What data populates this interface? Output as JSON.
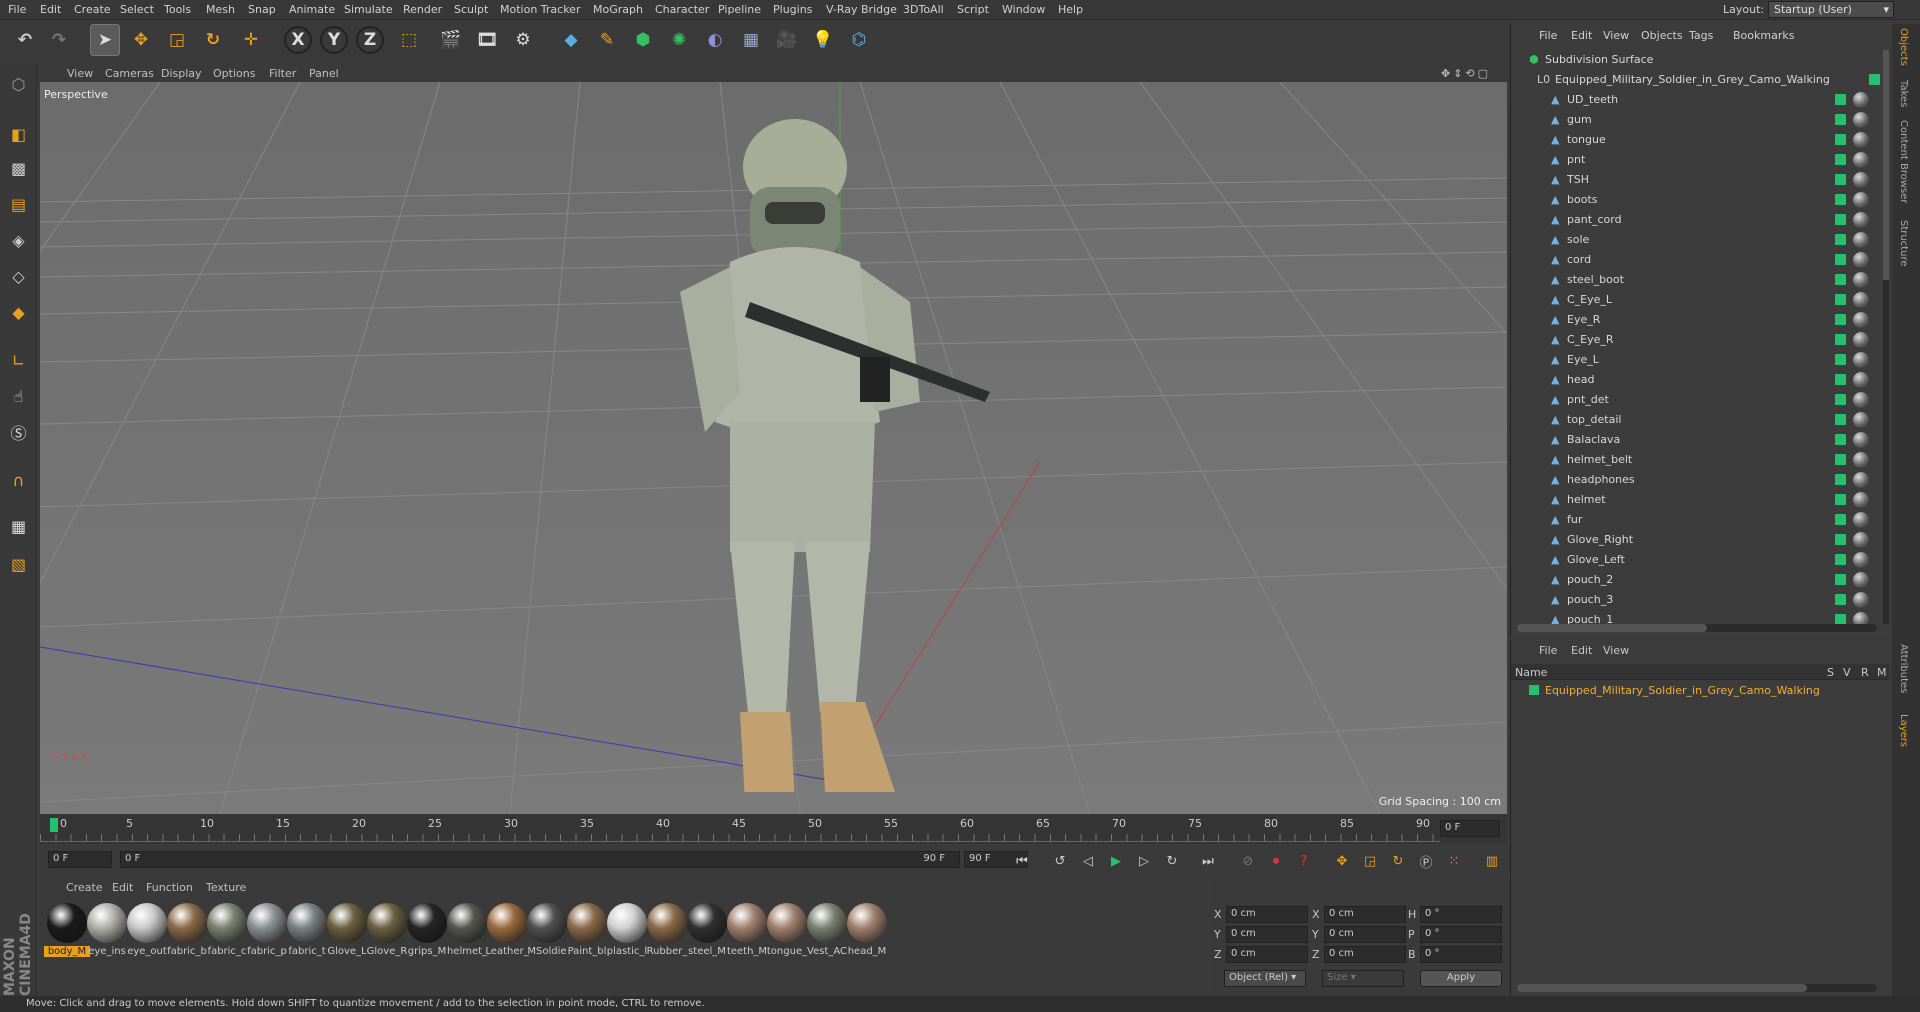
{
  "menubar": {
    "items": [
      "File",
      "Edit",
      "Create",
      "Select",
      "Tools",
      "Mesh",
      "Snap",
      "Animate",
      "Simulate",
      "Render",
      "Sculpt",
      "Motion Tracker",
      "MoGraph",
      "Character",
      "Pipeline",
      "Plugins",
      "V-Ray Bridge",
      "3DToAll",
      "Script",
      "Window",
      "Help"
    ],
    "layout_label": "Layout:",
    "layout_value": "Startup (User)"
  },
  "toolbar": {
    "icons": [
      "undo-icon",
      "redo-icon",
      "select-icon",
      "move-icon",
      "scale-icon",
      "rotate-icon",
      "last-tool-icon",
      "x-axis-icon",
      "y-axis-icon",
      "z-axis-icon",
      "coordinate-icon",
      "render-view-icon",
      "render-picture-icon",
      "render-settings-icon",
      "cube-icon",
      "pen-icon",
      "subdivision-icon",
      "cloner-icon",
      "deformer-icon",
      "floor-icon",
      "camera-icon",
      "light-icon",
      "python-icon"
    ],
    "axis_x": "X",
    "axis_y": "Y",
    "axis_z": "Z"
  },
  "viewport": {
    "menu": [
      "View",
      "Cameras",
      "Display",
      "Options",
      "Filter",
      "Panel"
    ],
    "label": "Perspective",
    "grid_spacing": "Grid Spacing : 100 cm"
  },
  "timeline": {
    "ticks": [
      "0",
      "5",
      "10",
      "15",
      "20",
      "25",
      "30",
      "35",
      "40",
      "45",
      "50",
      "55",
      "60",
      "65",
      "70",
      "75",
      "80",
      "85",
      "90"
    ],
    "current": "0 F",
    "start": "0 F",
    "range_left": "0 F",
    "range_right": "90 F",
    "end": "90 F"
  },
  "materials": {
    "menu": [
      "Create",
      "Edit",
      "Function",
      "Texture"
    ],
    "items": [
      {
        "name": "body_M",
        "color": "#1a1a1a",
        "sel": true
      },
      {
        "name": "eye_ins",
        "color": "#b0b0a8"
      },
      {
        "name": "eye_out",
        "color": "#c8c8c8"
      },
      {
        "name": "fabric_b",
        "color": "#8a6a4a"
      },
      {
        "name": "fabric_c",
        "color": "#7b7f70"
      },
      {
        "name": "fabric_p",
        "color": "#8a9090"
      },
      {
        "name": "fabric_t",
        "color": "#7a8080"
      },
      {
        "name": "Glove_L",
        "color": "#6b6040"
      },
      {
        "name": "Glove_R",
        "color": "#6b6040"
      },
      {
        "name": "grips_M",
        "color": "#252525"
      },
      {
        "name": "helmet_",
        "color": "#555550"
      },
      {
        "name": "Leather_",
        "color": "#9a6a40"
      },
      {
        "name": "MSoldie",
        "color": "#505050"
      },
      {
        "name": "Paint_bl",
        "color": "#8a6a4a"
      },
      {
        "name": "plastic_l",
        "color": "#d0d0d0"
      },
      {
        "name": "Rubber_",
        "color": "#8a6a4a"
      },
      {
        "name": "steel_M",
        "color": "#303030"
      },
      {
        "name": "teeth_M",
        "color": "#a08070"
      },
      {
        "name": "tongue_",
        "color": "#a08070"
      },
      {
        "name": "Vest_AC",
        "color": "#7a8070"
      },
      {
        "name": "head_M",
        "color": "#a08070"
      }
    ]
  },
  "attributes": {
    "x_label": "X",
    "y_label": "Y",
    "z_label": "Z",
    "h_label": "H",
    "p_label": "P",
    "b_label": "B",
    "pos": "0 cm",
    "rot": "0 °",
    "mode": "Object (Rel)",
    "size": "Size",
    "apply": "Apply"
  },
  "objmgr": {
    "menu": [
      "File",
      "Edit",
      "View",
      "Objects",
      "Tags",
      "Bookmarks"
    ],
    "root": "Subdivision Surface",
    "group": "Equipped_Military_Soldier_in_Grey_Camo_Walking",
    "objects": [
      "UD_teeth",
      "gum",
      "tongue",
      "pnt",
      "TSH",
      "boots",
      "pant_cord",
      "sole",
      "cord",
      "steel_boot",
      "C_Eye_L",
      "Eye_R",
      "C_Eye_R",
      "Eye_L",
      "head",
      "pnt_det",
      "top_detail",
      "Balaclava",
      "helmet_belt",
      "headphones",
      "helmet",
      "fur",
      "Glove_Right",
      "Glove_Left",
      "pouch_2",
      "pouch_3",
      "pouch_1"
    ]
  },
  "layers": {
    "menu": [
      "File",
      "Edit",
      "View"
    ],
    "col_name": "Name",
    "col_s": "S",
    "col_v": "V",
    "col_r": "R",
    "col_m": "M",
    "row": "Equipped_Military_Soldier_in_Grey_Camo_Walking"
  },
  "sidetabs": [
    "Objects",
    "Takes",
    "Content Browser",
    "Structure",
    "Attributes",
    "Layers"
  ],
  "status": "Move: Click and drag to move elements. Hold down SHIFT to quantize movement / add to the selection in point mode, CTRL to remove.",
  "colors": {
    "accent": "#e8a020",
    "green": "#26c26b",
    "selected_text": "#f0b030"
  }
}
